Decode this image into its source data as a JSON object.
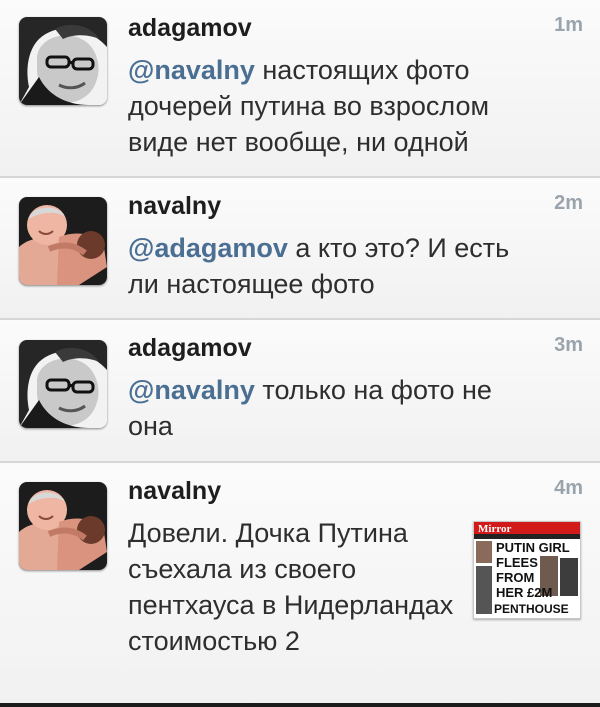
{
  "tweets": [
    {
      "username": "adagamov",
      "time": "1m",
      "mention": "@navalny",
      "text": " настоящих фото дочерей путина во взрослом виде нет вообще, ни одной",
      "avatar": "man-glasses-avatar"
    },
    {
      "username": "navalny",
      "time": "2m",
      "mention": "@adagamov",
      "text": " а кто это? И есть ли настоящее фото",
      "avatar": "wrestler-avatar"
    },
    {
      "username": "adagamov",
      "time": "3m",
      "mention": "@navalny",
      "text": " только на фото не она",
      "avatar": "man-glasses-avatar"
    },
    {
      "username": "navalny",
      "time": "4m",
      "mention": "",
      "text": "Довели. Дочка Путина съехала из своего пентхауса в Нидерландах стоимостью 2",
      "avatar": "wrestler-avatar",
      "thumbnail": {
        "masthead": "Mirror",
        "headline_lines": [
          "PUTIN GIRL",
          "FLEES",
          "FROM",
          "HER £2M",
          "PENTHOUSE"
        ]
      }
    }
  ],
  "colors": {
    "mention": "#4b6f93",
    "timestamp": "#9aa4ad",
    "masthead_red": "#d21a1a"
  }
}
